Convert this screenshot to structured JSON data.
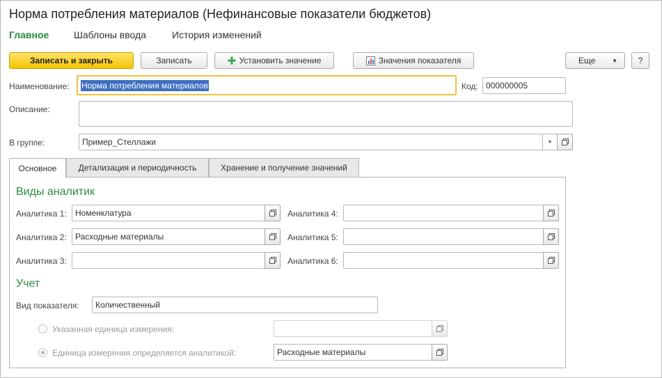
{
  "window": {
    "title": "Норма потребления материалов (Нефинансовые показатели бюджетов)"
  },
  "nav": [
    {
      "label": "Главное"
    },
    {
      "label": "Шаблоны ввода"
    },
    {
      "label": "История изменений"
    }
  ],
  "toolbar": {
    "save_close": "Записать и закрыть",
    "save": "Записать",
    "set_value": "Установить значение",
    "indicator_values": "Значения показателя",
    "more": "Еще",
    "help": "?"
  },
  "form": {
    "name_label": "Наименование:",
    "name_value": "Норма потребления материалов",
    "code_label": "Код:",
    "code_value": "000000005",
    "description_label": "Описание:",
    "description_value": "",
    "group_label": "В группе:",
    "group_value": "Пример_Стеллажи"
  },
  "tabs": [
    {
      "label": "Основное"
    },
    {
      "label": "Детализация и периодичность"
    },
    {
      "label": "Хранение и получение значений"
    }
  ],
  "analytics": {
    "section_title": "Виды аналитик",
    "items": [
      {
        "label": "Аналитика 1:",
        "value": "Номенклатура"
      },
      {
        "label": "Аналитика 2:",
        "value": "Расходные материалы"
      },
      {
        "label": "Аналитика 3:",
        "value": ""
      },
      {
        "label": "Аналитика 4:",
        "value": ""
      },
      {
        "label": "Аналитика 5:",
        "value": ""
      },
      {
        "label": "Аналитика 6:",
        "value": ""
      }
    ]
  },
  "accounting": {
    "section_title": "Учет",
    "indicator_type_label": "Вид показателя:",
    "indicator_type_value": "Количественный",
    "option_unit_label": "Указанная единица измерения:",
    "option_unit_value": "",
    "option_analytics_label": "Единица измерения определяется аналитикой:",
    "option_analytics_value": "Расходные материалы",
    "selected_option": "option_analytics"
  },
  "colors": {
    "accent_green": "#2a8a3d",
    "primary_button": "#f4c400",
    "focus_border": "#f0c23a",
    "selection": "#3f6fc1"
  }
}
